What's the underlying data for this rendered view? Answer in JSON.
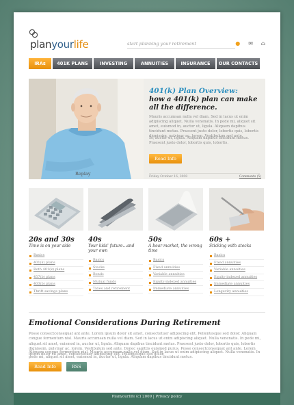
{
  "header": {
    "logo": {
      "plan": "plan",
      "your": "your",
      "life": "life"
    },
    "tagline": "start planning your retirement",
    "icons": [
      {
        "name": "home-icon",
        "glyph": "●",
        "color": "#f2a21e"
      },
      {
        "name": "contact-icon",
        "glyph": "✉",
        "color": "#666666"
      },
      {
        "name": "sitemap-icon",
        "glyph": "⌂",
        "color": "#666666"
      }
    ]
  },
  "nav": {
    "items": [
      {
        "label": "IRAs",
        "active": true
      },
      {
        "label": "401K PLANS",
        "active": false
      },
      {
        "label": "INVESTING",
        "active": false
      },
      {
        "label": "ANNUITIES",
        "active": false
      },
      {
        "label": "INSURANCE",
        "active": false
      },
      {
        "label": "OUR CONTACTS",
        "active": false
      }
    ]
  },
  "hero": {
    "replay": "Replay",
    "title": "401(k) Plan Overview:",
    "subtitle": "how a 401(k) plan can make all the difference.",
    "paragraph1": "Mauris accumsan nulla vel diam. Sed in lacus ut enim adipiscing aliquet. Nulla venenatis. In pede mi, aliquet sit amet, euismod in, auctor ut, ligula. Aliquam dapibus tincidunt metus. Praesent justo dolor, lobortis quis, lobortis dignissim, pulvinar ac, lorem. Vestibulum sed ante.",
    "paragraph2": "In, auctor ut, ligula. Aliquam dapibus tincidunt metus. Praesent justo dolor, lobortis quis, lobortis.",
    "read_button": "Read Info",
    "date": "Friday October 16, 2008",
    "comments": "Comments (5)"
  },
  "columns": [
    {
      "heading": "20s and 30s",
      "sub": "Time is on your side",
      "links": [
        "Basics",
        "401(k) plans",
        "Roth 401(k) plans",
        "457(b) plans",
        "403(b) plans",
        "Thrift savings plans"
      ]
    },
    {
      "heading": "40s",
      "sub": "Your kids' future...and your own",
      "links": [
        "Basics",
        "Stocks",
        "Bonds",
        "Mutual funds",
        "Taxes and retirement"
      ]
    },
    {
      "heading": "50s",
      "sub": "A bear market, the wrong time",
      "links": [
        "Basics",
        "Fixed annuities",
        "Variable annuities",
        "Equity-indexed annuities",
        "Immediate annuities"
      ]
    },
    {
      "heading": "60s +",
      "sub": "Sticking with stocks",
      "links": [
        "Basics",
        "Fixed annuities",
        "Variable annuities",
        "Equity-indexed annuities",
        "Immediate annuities",
        "Longevity annuities"
      ]
    }
  ],
  "bottom": {
    "title": "Emotional Considerations During Retirement",
    "paragraph1": "Posse consectconsequat ant ante. Lorem ipsum dolor sit amet, consectetuer adipiscing elit. Pellentesque sed dolor. Aliquam congue fermentum nisl. Mauris accumsan nulla vel diam. Sed in lacus ut enim adipiscing aliquet. Nulla venenatis. In pede mi, aliquet sit amet, euismod in, auctor ut, ligula. Aliquam dapibus tincidunt metus. Praesent justo dolor, lobortis quis, lobortis dignissim, pulvinar ac, lorem. Vestibulum sed ante. Donec sagittis euismod purus. Posse consectconsequat ant ante. Lorem ipsum dolor sit amet, consectetuer adipiscing elit. Pellentesque sed dolor.",
    "paragraph2": "Aliquam congue fermentum nisl. Mauris accumsan nulla vel diam. Sed in lacus ut enim adipiscing aliquet. Nulla venenatis. In pede mi, aliquet sit amet, euismod in, auctor ut, ligula. Aliquam dapibus tincidunt metus.",
    "read_button": "Read Info",
    "rss_button": "RSS"
  },
  "footer": {
    "text": "Planyourlife (c) 2009 | Privacy policy"
  }
}
